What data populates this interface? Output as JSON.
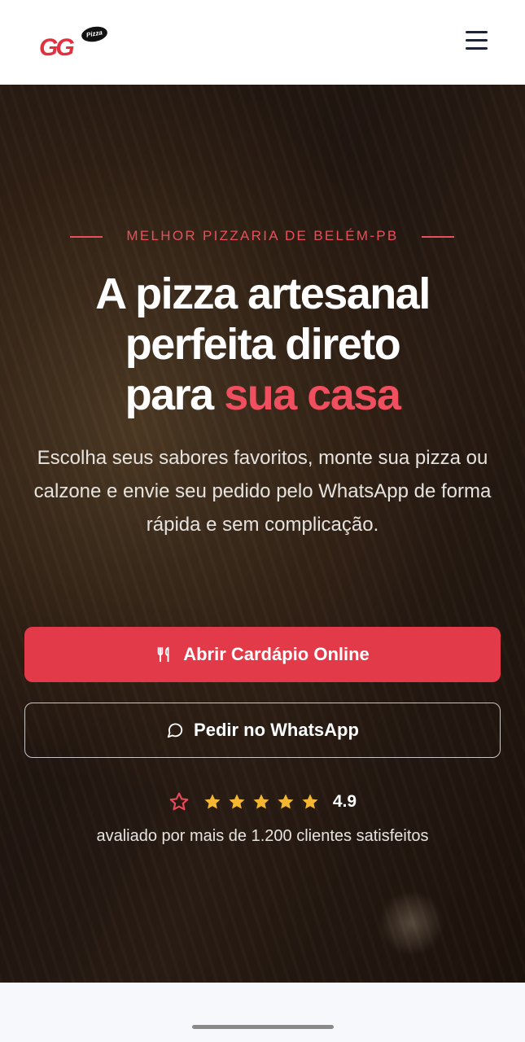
{
  "header": {
    "logo_text": "GG",
    "logo_badge": "Pizza"
  },
  "hero": {
    "eyebrow": "MELHOR PIZZARIA DE BELÉM-PB",
    "headline_line1": "A pizza artesanal",
    "headline_line2": "perfeita direto",
    "headline_line3_plain": "para ",
    "headline_line3_accent": "sua casa",
    "subtitle": "Escolha seus sabores favoritos, monte sua pizza ou calzone e envie seu pedido pelo WhatsApp de forma rápida e sem complicação.",
    "primary_button": "Abrir Cardápio Online",
    "secondary_button": "Pedir no WhatsApp",
    "rating": {
      "value": "4.9",
      "stars": 5,
      "caption": "avaliado por mais de 1.200 clientes satisfeitos"
    }
  },
  "colors": {
    "accent": "#e33a4a",
    "star": "#f5b731",
    "header_bg": "#ffffff"
  },
  "icons": [
    "menu-icon",
    "utensils-icon",
    "chat-bubble-icon",
    "star-outline-icon",
    "star-icon"
  ]
}
